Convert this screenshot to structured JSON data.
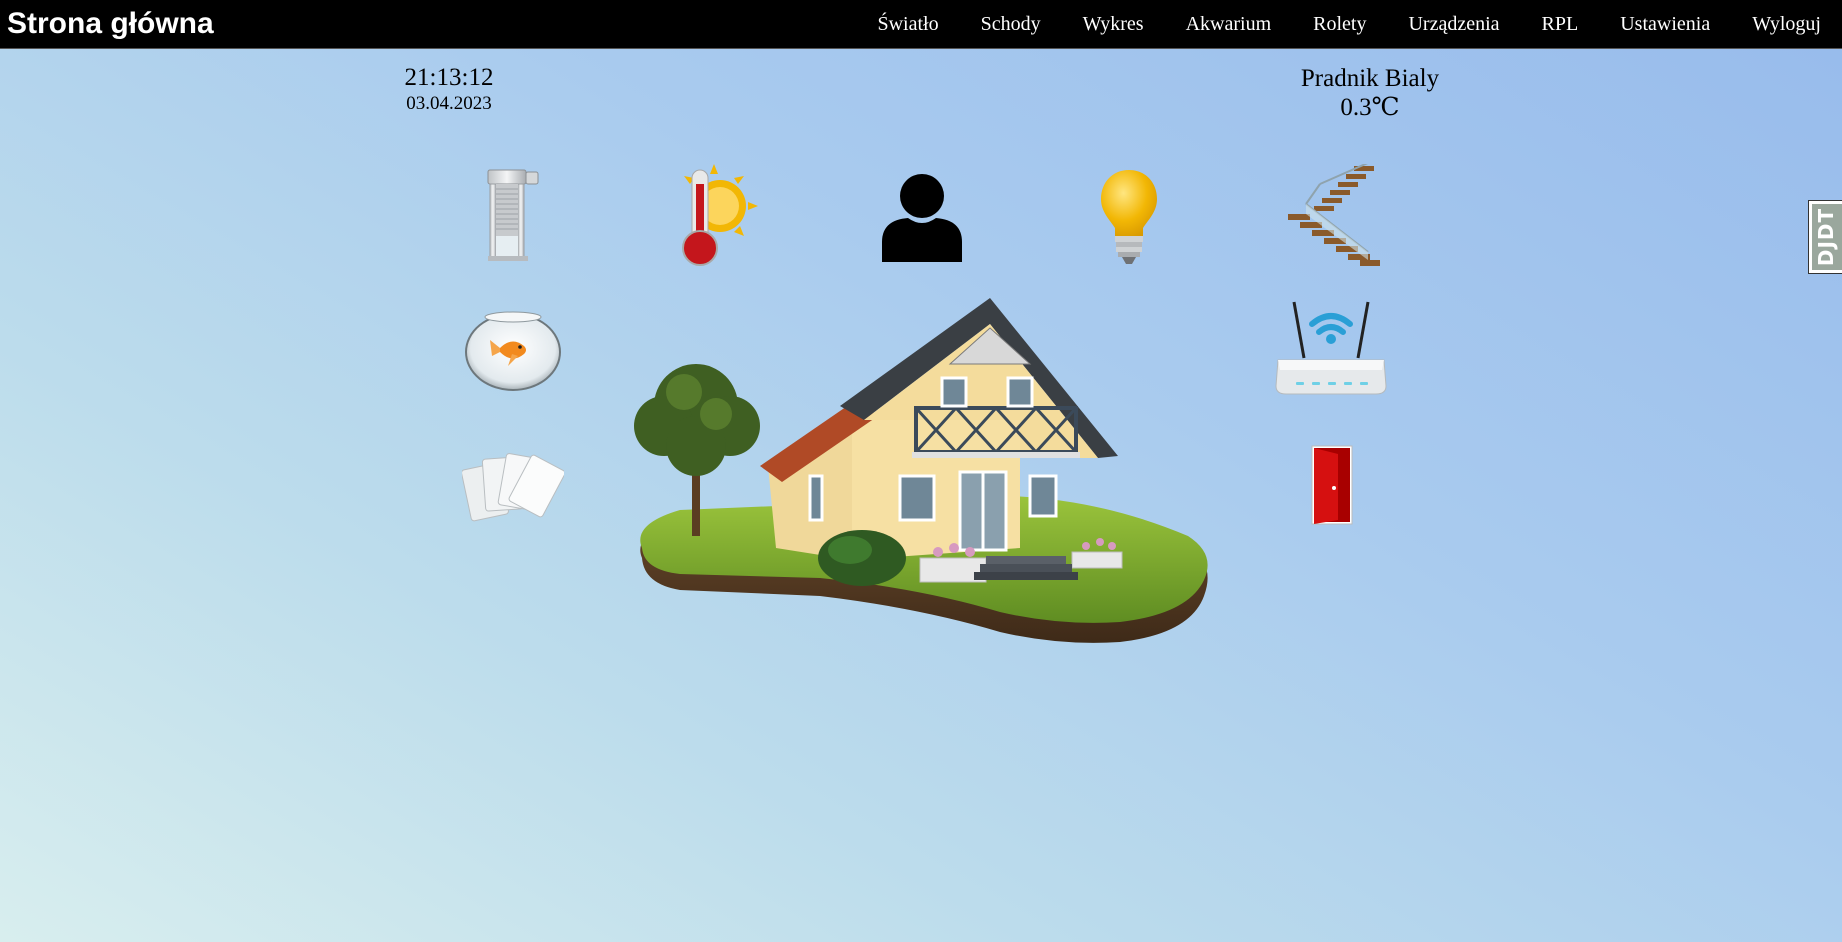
{
  "header": {
    "title": "Strona główna",
    "nav": [
      {
        "label": "Światło"
      },
      {
        "label": "Schody"
      },
      {
        "label": "Wykres"
      },
      {
        "label": "Akwarium"
      },
      {
        "label": "Rolety"
      },
      {
        "label": "Urządzenia"
      },
      {
        "label": "RPL"
      },
      {
        "label": "Ustawienia"
      },
      {
        "label": "Wyloguj"
      }
    ]
  },
  "clock": {
    "time": "21:13:12",
    "date": "03.04.2023"
  },
  "weather": {
    "location": "Pradnik Bialy",
    "temperature": "0.3℃"
  },
  "tiles": [
    {
      "name": "roller-blinds",
      "icon": "roller-blind-icon"
    },
    {
      "name": "temperature",
      "icon": "thermometer-sun-icon"
    },
    {
      "name": "user",
      "icon": "user-icon"
    },
    {
      "name": "light",
      "icon": "light-bulb-icon"
    },
    {
      "name": "stairs",
      "icon": "stairs-icon"
    },
    {
      "name": "aquarium",
      "icon": "fishbowl-icon"
    },
    {
      "name": "devices",
      "icon": "wifi-router-icon"
    },
    {
      "name": "cards",
      "icon": "rfid-cards-icon"
    },
    {
      "name": "logout",
      "icon": "door-icon"
    },
    {
      "name": "house",
      "icon": "house-illustration"
    }
  ],
  "debug_toolbar": {
    "label": "DJDT"
  },
  "colors": {
    "topbar": "#000000",
    "background_left": "#d8eeee",
    "background_right": "#97bbec",
    "door": "#c00000",
    "bulb": "#f2b705"
  }
}
